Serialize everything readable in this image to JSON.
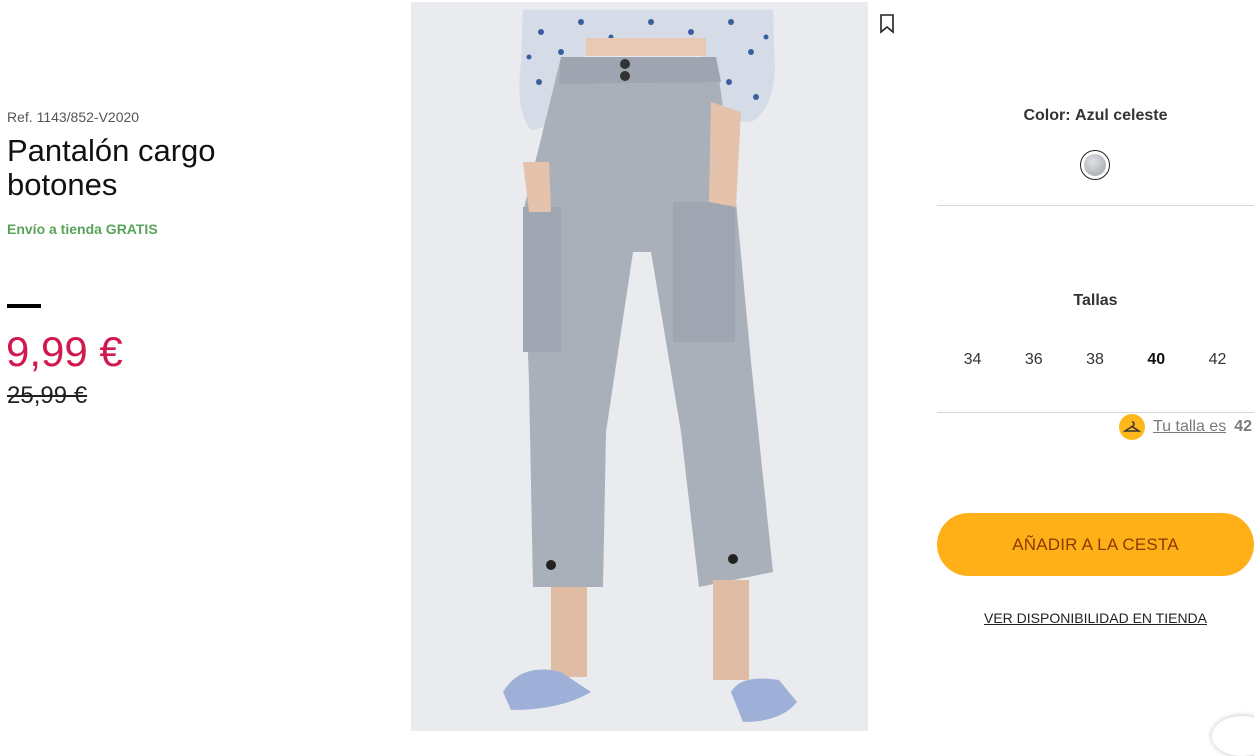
{
  "product": {
    "reference": "Ref. 1143/852-V2020",
    "title": "Pantalón cargo botones",
    "shipping": "Envío a tienda GRATIS",
    "price": "9,99 €",
    "old_price": "25,99 €"
  },
  "color": {
    "label": "Color:",
    "value": "Azul celeste",
    "swatch_hex": "#b3b6bb"
  },
  "sizes": {
    "label": "Tallas",
    "options": [
      "34",
      "36",
      "38",
      "40",
      "42"
    ],
    "selected": "40"
  },
  "fit": {
    "text": "Tu talla es",
    "size": "42",
    "icon": "hanger-icon"
  },
  "actions": {
    "add_to_cart": "AÑADIR A LA CESTA",
    "store_availability": "VER DISPONIBILIDAD EN TIENDA"
  },
  "colors": {
    "accent": "#ffb019",
    "price": "#d1194f",
    "shipping": "#5aa35a"
  }
}
